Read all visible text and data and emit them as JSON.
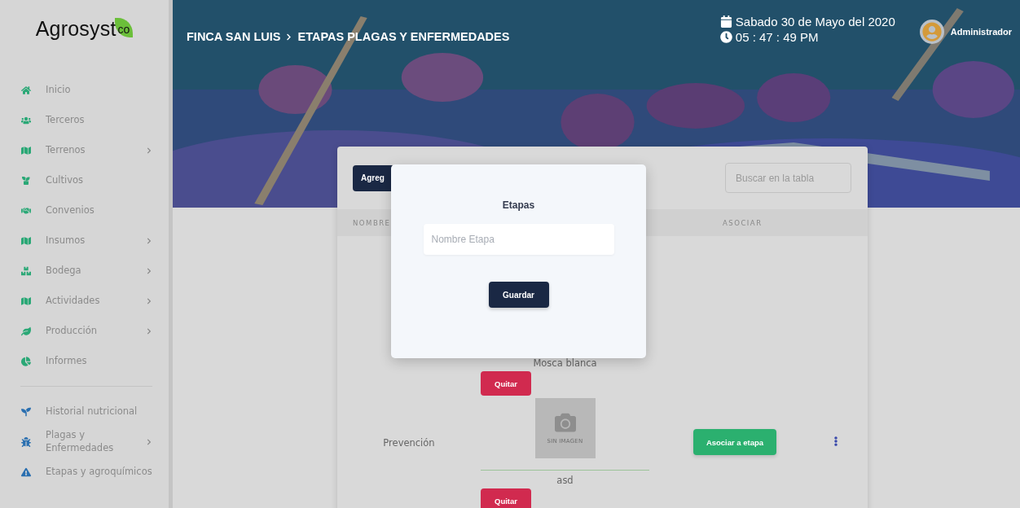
{
  "logo": {
    "name": "Agrosyst",
    "suffix": "co"
  },
  "sidebar": {
    "sections": [
      {
        "kind": "modules",
        "items": [
          {
            "label": "Inicio",
            "has_submenu": false
          },
          {
            "label": "Terceros",
            "has_submenu": false
          },
          {
            "label": "Terrenos",
            "has_submenu": true
          },
          {
            "label": "Cultivos",
            "has_submenu": false
          },
          {
            "label": "Convenios",
            "has_submenu": false
          },
          {
            "label": "Insumos",
            "has_submenu": true
          },
          {
            "label": "Bodega",
            "has_submenu": true
          },
          {
            "label": "Actividades",
            "has_submenu": true
          },
          {
            "label": "Producción",
            "has_submenu": true
          },
          {
            "label": "Informes",
            "has_submenu": false
          }
        ]
      },
      {
        "kind": "tools",
        "items": [
          {
            "label": "Historial nutricional",
            "has_submenu": false
          },
          {
            "label": "Plagas y Enfermedades",
            "has_submenu": true
          },
          {
            "label": "Etapas y agroquímicos",
            "has_submenu": false
          }
        ]
      }
    ]
  },
  "header": {
    "breadcrumb": [
      "FINCA SAN LUIS",
      "ETAPAS PLAGAS Y ENFERMEDADES"
    ],
    "date": "Sabado 30 de Mayo del 2020",
    "time": "05 : 47 : 49 PM",
    "user": "Administrador"
  },
  "card": {
    "add_button": "Agreg",
    "search": {
      "placeholder": "Buscar en la tabla"
    },
    "table": {
      "columns": [
        "NOMBRE",
        "ASOCIAR"
      ],
      "row": {
        "name": "Prevención",
        "pests": [
          {
            "name": "Mosca blanca",
            "remove": "Quitar",
            "image": "SIN IMAGEN"
          },
          {
            "name": "asd",
            "remove": "Quitar"
          }
        ],
        "action": "Asociar a etapa"
      }
    }
  },
  "modal": {
    "title": "Etapas",
    "field": {
      "placeholder": "Nombre Etapa"
    },
    "button": "Guardar"
  }
}
